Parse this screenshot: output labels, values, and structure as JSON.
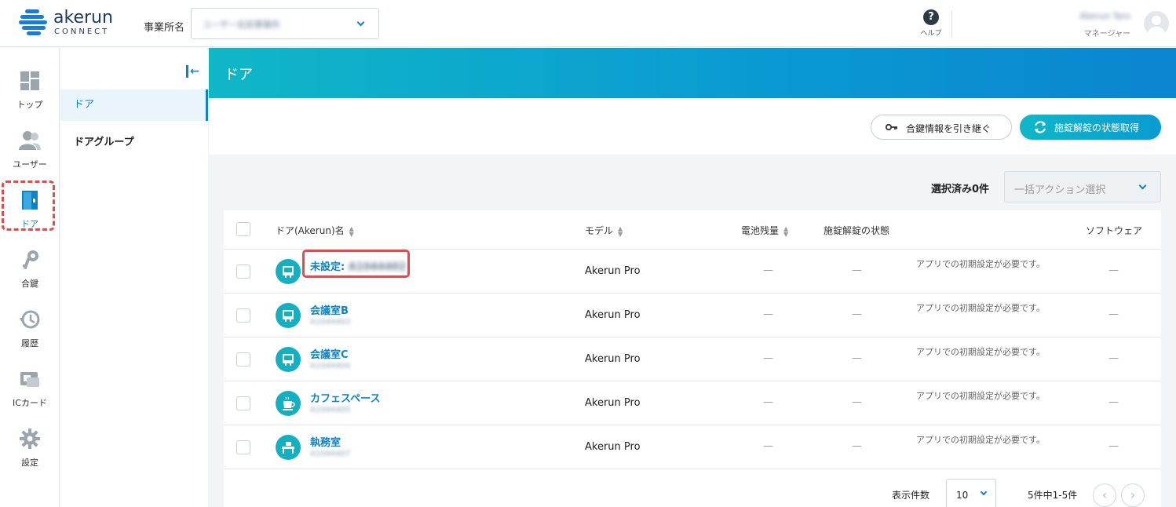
{
  "header": {
    "logo_text": "akerun",
    "logo_sub": "CONNECT",
    "office_label": "事業所名",
    "office_value": "ユーザー名前事業所",
    "help_label": "ヘルプ",
    "user_name": "Akerun Taro",
    "user_role": "マネージャー"
  },
  "rail": {
    "items": [
      {
        "label": "トップ",
        "icon": "dashboard-icon"
      },
      {
        "label": "ユーザー",
        "icon": "users-icon"
      },
      {
        "label": "ドア",
        "icon": "door-icon"
      },
      {
        "label": "合鍵",
        "icon": "key-icon"
      },
      {
        "label": "履歴",
        "icon": "history-icon"
      },
      {
        "label": "ICカード",
        "icon": "ic-card-icon"
      },
      {
        "label": "設定",
        "icon": "gear-icon"
      }
    ],
    "active_color": "#0b84c6"
  },
  "subnav": {
    "items": [
      {
        "label": "ドア"
      },
      {
        "label": "ドアグループ"
      }
    ]
  },
  "page": {
    "title": "ドア",
    "transfer_button": "合鍵情報を引き継ぐ",
    "fetch_button": "施錠解錠の状態取得",
    "selection_label": "選択済み0件",
    "bulk_placeholder": "一括アクション選択"
  },
  "table": {
    "columns": {
      "name": "ドア(Akerun)名",
      "model": "モデル",
      "battery": "電池残量",
      "lock_state": "施錠解錠の状態",
      "software": "ソフトウェア"
    },
    "rows": [
      {
        "name": "未設定:",
        "name_suffix": "A1044402",
        "model": "Akerun Pro",
        "battery": "—",
        "lock_state": "—",
        "note": "アプリでの初期設定が必要です。",
        "software": "—",
        "icon": "door-icon"
      },
      {
        "name": "会議室B",
        "id": "A1044403",
        "model": "Akerun Pro",
        "battery": "—",
        "lock_state": "—",
        "note": "アプリでの初期設定が必要です。",
        "software": "—",
        "icon": "door-icon"
      },
      {
        "name": "会議室C",
        "id": "A1044404",
        "model": "Akerun Pro",
        "battery": "—",
        "lock_state": "—",
        "note": "アプリでの初期設定が必要です。",
        "software": "—",
        "icon": "door-icon"
      },
      {
        "name": "カフェスペース",
        "id": "A1044405",
        "model": "Akerun Pro",
        "battery": "—",
        "lock_state": "—",
        "note": "アプリでの初期設定が必要です。",
        "software": "—",
        "icon": "coffee-icon"
      },
      {
        "name": "執務室",
        "id": "A1044407",
        "model": "Akerun Pro",
        "battery": "—",
        "lock_state": "—",
        "note": "アプリでの初期設定が必要です。",
        "software": "—",
        "icon": "desk-icon"
      }
    ]
  },
  "pager": {
    "per_page_label": "表示件数",
    "per_page_value": "10",
    "range": "5件中1-5件",
    "prev": "‹",
    "next": "›"
  }
}
